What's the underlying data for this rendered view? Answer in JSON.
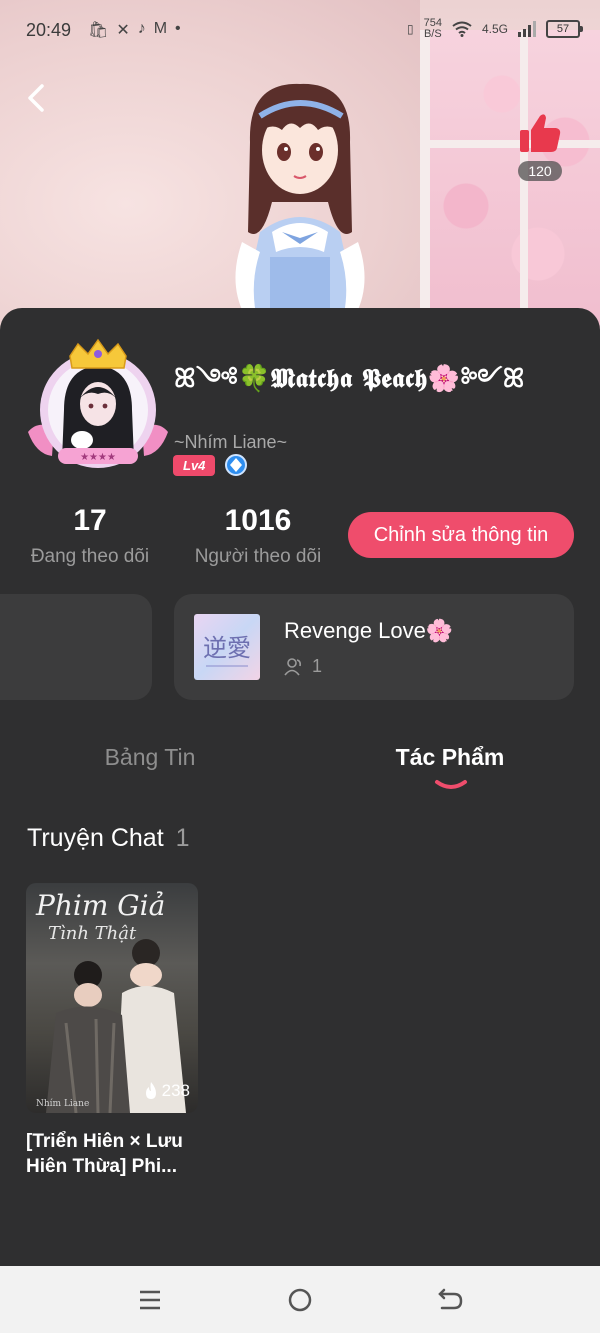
{
  "status_bar": {
    "time": "20:49",
    "net_speed_value": "754",
    "net_speed_unit": "B/S",
    "network": "4.5G",
    "battery": "57"
  },
  "header": {
    "likes": "120"
  },
  "profile": {
    "nickname": "ꕤ༺🍀𝕸𝖆𝖙𝖈𝖍𝖆 𝕻𝖊𝖆𝖈𝖍🌸༻ꕤ",
    "subname": "~Nhím Liane~",
    "level": "Lv4"
  },
  "stats": {
    "following_count": "17",
    "following_label": "Đang theo dõi",
    "followers_count": "1016",
    "followers_label": "Người theo dõi"
  },
  "edit_button": "Chỉnh sửa thông tin",
  "group": {
    "title": "Revenge Love🌸",
    "thumb_text": "逆愛",
    "members": "1"
  },
  "tabs": [
    {
      "label": "Bảng Tin"
    },
    {
      "label": "Tác Phẩm"
    }
  ],
  "section": {
    "title": "Truyện Chat",
    "count": "1"
  },
  "stories": [
    {
      "cover_title": "Phim Giả",
      "cover_subtitle": "Tình Thật",
      "cover_credit": "Nhím Liane",
      "views": "238",
      "title": "[Triển Hiên × Lưu Hiên Thừa] Phi..."
    }
  ],
  "colors": {
    "accent": "#ef4d6c",
    "card_bg": "#2f2f30",
    "group_bg": "#3c3c3d"
  }
}
